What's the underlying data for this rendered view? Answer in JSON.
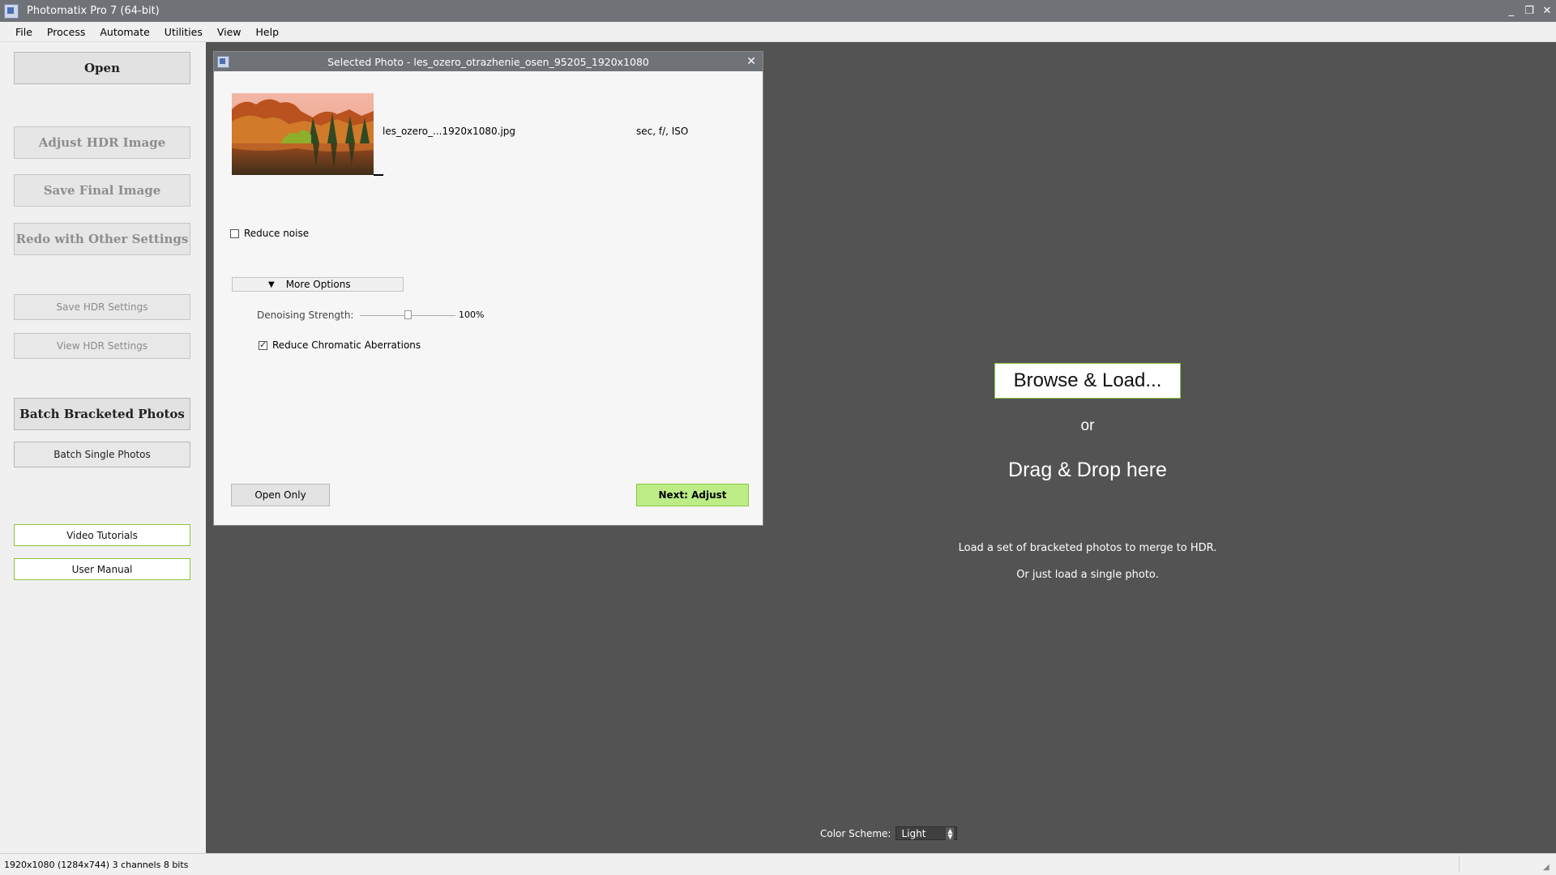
{
  "window": {
    "title": "Photomatix Pro 7  (64-bit)",
    "minimize": "_",
    "restore": "❐",
    "close": "✕"
  },
  "menu": [
    "File",
    "Process",
    "Automate",
    "Utilities",
    "View",
    "Help"
  ],
  "sidebar": {
    "open": "Open",
    "adjust_hdr": "Adjust HDR Image",
    "save_final": "Save Final Image",
    "redo": "Redo with Other Settings",
    "save_hdr_settings": "Save HDR Settings",
    "view_hdr_settings": "View HDR Settings",
    "batch_bracketed": "Batch Bracketed Photos",
    "batch_single": "Batch Single Photos",
    "video_tutorials": "Video Tutorials",
    "user_manual": "User Manual"
  },
  "dialog": {
    "title": "Selected Photo - les_ozero_otrazhenie_osen_95205_1920x1080",
    "close": "✕",
    "filename": "les_ozero_...1920x1080.jpg",
    "exif": "sec, f/, ISO",
    "reduce_noise": "Reduce noise",
    "reduce_noise_checked": false,
    "more_options": "More Options",
    "denoising_label": "Denoising Strength:",
    "denoising_value": "100%",
    "denoising_level": 0.5,
    "reduce_ca": "Reduce Chromatic Aberrations",
    "reduce_ca_checked": true,
    "open_only": "Open Only",
    "next_adjust": "Next: Adjust"
  },
  "drop_zone": {
    "browse": "Browse & Load...",
    "or": "or",
    "drag": "Drag & Drop here",
    "hint1": "Load a set of bracketed photos to merge to HDR.",
    "hint2": "Or just load a single photo."
  },
  "color_scheme": {
    "label": "Color Scheme:",
    "value": "Light"
  },
  "status": {
    "text": "1920x1080 (1284x744) 3 channels 8 bits"
  },
  "colors": {
    "accent_green": "#8cc63f",
    "next_button": "#bdec86",
    "main_bg": "#535353",
    "titlebar": "#6f7378"
  }
}
